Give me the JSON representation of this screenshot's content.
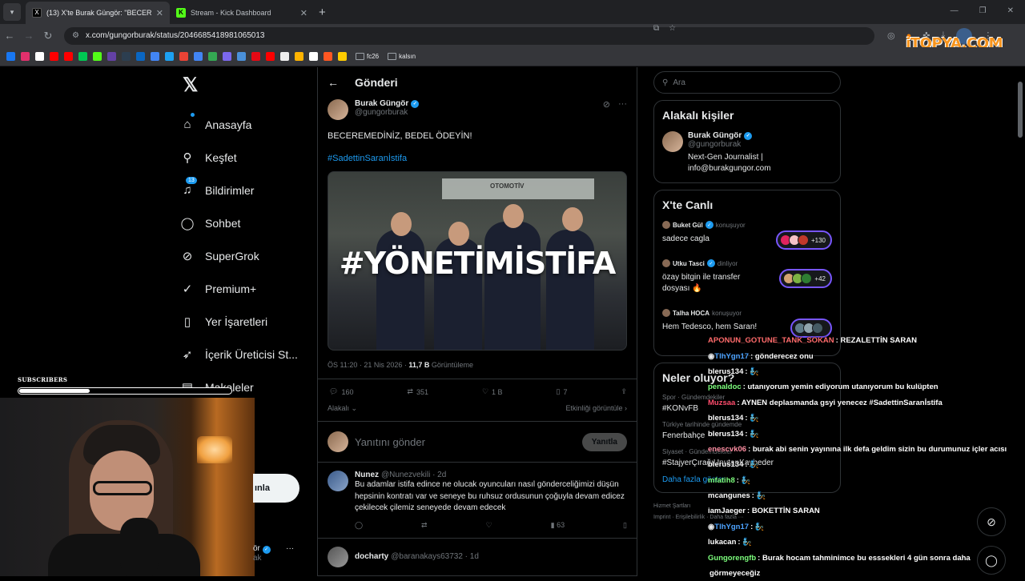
{
  "browser": {
    "tabs": [
      {
        "title": "(13) X'te Burak Güngör: \"BECER",
        "fav_color": "#000000",
        "fav_glyph": "X"
      },
      {
        "title": "Stream - Kick Dashboard",
        "fav_color": "#53fc18",
        "fav_glyph": "K"
      }
    ],
    "url": "x.com/gungorburak/status/2046685418981065013",
    "bookmark_folders": [
      "fc26",
      "kalsın"
    ],
    "bookmark_colors": [
      "#1877f2",
      "#e1306c",
      "#ffffff",
      "#ff0000",
      "#ff0000",
      "#00c853",
      "#53fc18",
      "#6441a5",
      "#2c3e50",
      "#0a66c2",
      "#4285f4",
      "#1da1f2",
      "#ea4335",
      "#4285f4",
      "#34a853",
      "#7b68ee",
      "#4a90d9",
      "#e50914",
      "#ff0000",
      "#eeeeee",
      "#ffb300",
      "#ffffff",
      "#ff5722",
      "#ffcc00"
    ]
  },
  "watermark": "iTOPYA.COM",
  "nav": {
    "items": [
      {
        "label": "Anasayfa",
        "icon": "home-icon",
        "glyph": "⌂"
      },
      {
        "label": "Keşfet",
        "icon": "search-icon",
        "glyph": "⚲"
      },
      {
        "label": "Bildirimler",
        "icon": "bell-icon",
        "glyph": "♫",
        "badge": "13"
      },
      {
        "label": "Sohbet",
        "icon": "chat-icon",
        "glyph": "◯"
      },
      {
        "label": "SuperGrok",
        "icon": "grok-icon",
        "glyph": "⊘"
      },
      {
        "label": "Premium+",
        "icon": "premium-icon",
        "glyph": "✓"
      },
      {
        "label": "Yer İşaretleri",
        "icon": "bookmark-icon",
        "glyph": "▯"
      },
      {
        "label": "İçerik Üreticisi St...",
        "icon": "rocket-icon",
        "glyph": "➶"
      },
      {
        "label": "Makaleler",
        "icon": "article-icon",
        "glyph": "▤"
      }
    ],
    "post_button": "ınla",
    "profile_fragment": "ör",
    "profile_handle_fragment": "ak"
  },
  "main": {
    "header": "Gönderi",
    "author_name": "Burak Güngör",
    "author_handle": "@gungorburak",
    "tweet_text": "BECEREMEDİNİZ, BEDEL ÖDEYİN!",
    "hashtag": "#SadettinSaranİstifa",
    "media_overlay": "#YÖNETİMİSTİFA",
    "media_sign": "OTOMOTİV",
    "time": "ÖS 11:20 · 21 Nis 2026 · ",
    "views": "11,7 B",
    "views_label": " Görüntüleme",
    "stats": {
      "replies": "160",
      "retweets": "351",
      "likes": "1 B",
      "bookmarks": "7"
    },
    "sort_label": "Alakalı",
    "activity_label": "Etkinliği görüntüle",
    "reply_placeholder": "Yanıtını gönder",
    "reply_button": "Yanıtla",
    "replies": [
      {
        "name": "Nunez",
        "handle": "@Nunezvekili · 2d",
        "text": "Bu adamlar istifa edince ne olucak oyuncuları nasıl gönderceliğimizi düşün hepsinin kontratı var ve seneye bu ruhsuz ordusunun çoğuyla devam edicez çekilecek çilemiz seneyede devam edecek",
        "views": "63"
      },
      {
        "name": "docharty",
        "handle": "@baranakays63732 · 1d",
        "text": "",
        "views": ""
      }
    ]
  },
  "right": {
    "search_placeholder": "Ara",
    "people_title": "Alakalı kişiler",
    "person_name": "Burak Güngör",
    "person_handle": "@gungorburak",
    "person_bio": "Next-Gen Journalist | info@burakgungor.com",
    "live_title": "X'te Canlı",
    "live": [
      {
        "name": "Buket Gül",
        "status": "konuşuyor",
        "title": "sadece cagla",
        "count": "+130"
      },
      {
        "name": "Utku Tasci",
        "status": "dinliyor",
        "title": "özay bitgin ile transfer dosyası 🔥",
        "count": "+42"
      },
      {
        "name": "Talha HOCA",
        "status": "konuşuyor",
        "title": "Hem Tedesco, hem Saran!",
        "count": ""
      }
    ],
    "trends_title": "Neler oluyor?",
    "trends": [
      {
        "cat": "Spor · Gündemdekiler",
        "name": "#KONvFB"
      },
      {
        "cat": "Türkiye tarihinde gündemde",
        "name": "Fenerbahçe"
      },
      {
        "cat": "Siyaset · Gündemdekiler",
        "name": "#StajyerÇırağıUnutanKaybeder"
      }
    ],
    "more_label": "Daha fazla göster",
    "footer1": "Hizmet Şartları",
    "footer2": "Imprint · Erişilebilirlik · Daha fazla ···"
  },
  "overlay": {
    "subs_label": "SUBSCRIBERS",
    "subs_progress": 0.33,
    "chat": [
      {
        "user": "APONUN_GOTUNE_TANK_SOKAN",
        "color": "#ff6b6b",
        "text": ": REZALETTİN SARAN"
      },
      {
        "user": "TlhYgn17",
        "color": "#4da3ff",
        "text": ": gönderecez onu",
        "badge": true
      },
      {
        "user": "blerus134",
        "color": "#ffffff",
        "text": ": 🧞"
      },
      {
        "user": "penaldoc",
        "color": "#7dff7d",
        "text": ": utanıyorum yemin ediyorum utanıyorum bu kulüpten"
      },
      {
        "user": "Muzsaa",
        "color": "#ff4d6d",
        "text": ": AYNEN deplasmanda gsyi yenecez #SadettinSaranİstifa"
      },
      {
        "user": "blerus134",
        "color": "#ffffff",
        "text": ": 🧞"
      },
      {
        "user": "blerus134",
        "color": "#ffffff",
        "text": ": 🧞"
      },
      {
        "user": "enescvk06",
        "color": "#ff8fa3",
        "text": ": burak abi senin yayınına ilk defa geldim sizin bu durumunuz içler acısı"
      },
      {
        "user": "blerus134",
        "color": "#ffffff",
        "text": ": 🧞"
      },
      {
        "user": "mfatih8",
        "color": "#7dff7d",
        "text": ": 🧞"
      },
      {
        "user": "mcangunes",
        "color": "#ffffff",
        "text": ": 🧞"
      },
      {
        "user": "iamJaeger",
        "color": "#ffffff",
        "text": ": BOKETTİN SARAN"
      },
      {
        "user": "TlhYgn17",
        "color": "#4da3ff",
        "text": ": 🧞",
        "badge": true
      },
      {
        "user": "lukacan",
        "color": "#ffffff",
        "text": ": 🧞"
      },
      {
        "user": "Gungorengfb",
        "color": "#7dff7d",
        "text": ": Burak hocam tahminimce bu esssekleri 4 gün sonra daha"
      },
      {
        "user": "",
        "color": "#ffffff",
        "text": "görmeyeceğiz"
      }
    ]
  }
}
